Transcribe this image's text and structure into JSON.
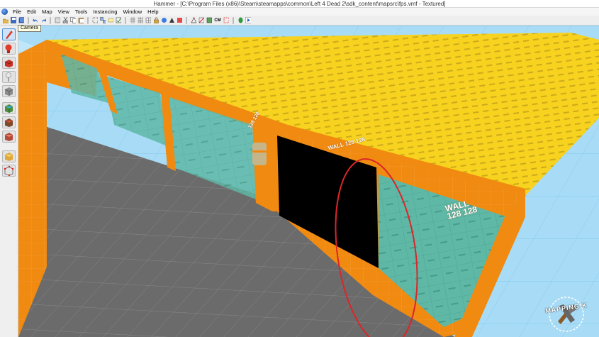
{
  "window": {
    "title": "Hammer - [C:\\Program Files (x86)\\Steam\\steamapps\\common\\Left 4 Dead 2\\sdk_content\\mapsrc\\fps.vmf - Textured]"
  },
  "menu": {
    "items": [
      "File",
      "Edit",
      "Map",
      "View",
      "Tools",
      "Instancing",
      "Window",
      "Help"
    ]
  },
  "toolbar": {
    "buttons": [
      "open-icon",
      "save-icon",
      "undo-icon",
      "redo-icon",
      "cut-icon",
      "copy-icon",
      "paste-icon",
      "carve-icon",
      "group-icon",
      "ungroup-icon",
      "hide-icon",
      "grid-icon",
      "texture-lock-icon",
      "entity-icon",
      "compile-icon",
      "run-map-icon"
    ],
    "cm_label": "CM"
  },
  "tooltip": {
    "text": "Camera"
  },
  "sidebar": {
    "tools": [
      "selection-tool-icon",
      "magnify-tool-icon",
      "camera-tool-icon",
      "entity-tool-icon",
      "block-tool-icon",
      "texture-tool-icon",
      "apply-texture-icon",
      "decal-tool-icon",
      "overlay-tool-icon",
      "clipping-tool-icon",
      "vertex-tool-icon"
    ]
  },
  "viewport": {
    "wall_label": "WALL\n128 128",
    "small_labels": [
      "WALL 128 128",
      "128 128"
    ],
    "colors": {
      "sky": "#a8dcf6",
      "ceiling": "#f7d21e",
      "wall_orange": "#f08a10",
      "floor": "#6b6b6b",
      "glass": "#5fb8a6",
      "door": "#000000",
      "highlight_circle": "#d9262a"
    }
  },
  "watermark": {
    "text": "MAPPING K"
  }
}
